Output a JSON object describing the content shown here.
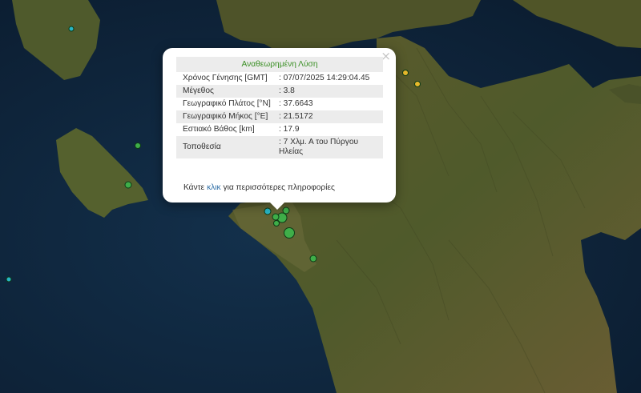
{
  "popup": {
    "title": "Αναθεωρημένη Λύση",
    "close_glyph": "×",
    "rows": [
      {
        "label": "Χρόνος Γένησης [GMT]",
        "value": ": 07/07/2025 14:29:04.45"
      },
      {
        "label": "Μέγεθος",
        "value": ": 3.8"
      },
      {
        "label": "Γεωγραφικό Πλάτος [°N]",
        "value": ": 37.6643"
      },
      {
        "label": "Γεωγραφικό Μήκος [°E]",
        "value": ": 21.5172"
      },
      {
        "label": "Εστιακό Βάθος [km]",
        "value": ": 17.9"
      },
      {
        "label": "Τοποθεσία",
        "value": ": 7 Χλμ. Α του Πύργου Ηλείας"
      }
    ],
    "more_prefix": "Κάντε",
    "more_link": "κλικ",
    "more_suffix": "για περισσότερες πληροφορίες"
  },
  "colors": {
    "sea": "#0e2238",
    "land": "#55532a",
    "marker_green": "#3fae49",
    "marker_cyan": "#27b6c6",
    "marker_yellow": "#e8b92b",
    "title_green": "#3a8f24",
    "link_blue": "#2f6fa6"
  }
}
